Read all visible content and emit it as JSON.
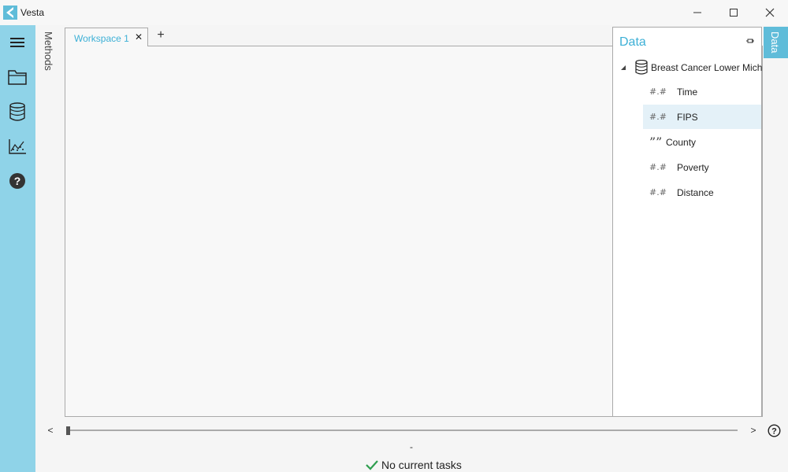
{
  "window": {
    "title": "Vesta",
    "accent_color": "#3db0d6",
    "rail_color": "#8fd3e8"
  },
  "left_rail": {
    "items": [
      {
        "icon": "menu-icon"
      },
      {
        "icon": "folder-icon"
      },
      {
        "icon": "database-icon"
      },
      {
        "icon": "chart-icon"
      },
      {
        "icon": "help-icon"
      }
    ]
  },
  "methods_tab": {
    "label": "Methods"
  },
  "workspace": {
    "tabs": [
      {
        "label": "Workspace 1",
        "close": "✕"
      }
    ],
    "add_tab": "+"
  },
  "data_panel": {
    "header": "Data",
    "dataset": "Breast Cancer Lower Mich",
    "fields": [
      {
        "label": "Time",
        "type": "numeric",
        "selected": false
      },
      {
        "label": "FIPS",
        "type": "numeric",
        "selected": true
      },
      {
        "label": "County",
        "type": "text",
        "selected": false
      },
      {
        "label": "Poverty",
        "type": "numeric",
        "selected": false
      },
      {
        "label": "Distance",
        "type": "numeric",
        "selected": false
      }
    ]
  },
  "data_side_tab": {
    "label": "Data"
  },
  "bottom": {
    "scroll_left": "<",
    "scroll_right": ">",
    "slider_value": "-",
    "status_text": "No current tasks",
    "slider_position": 0
  }
}
